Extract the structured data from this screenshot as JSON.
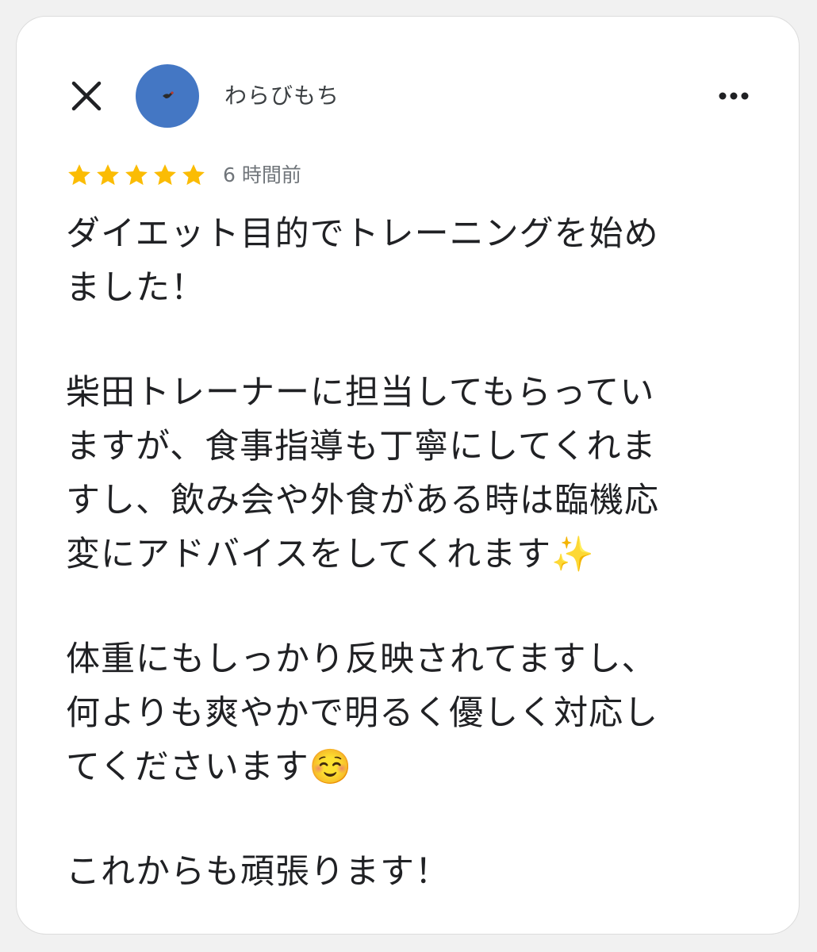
{
  "review": {
    "author": "わらびもち",
    "time": "6 時間前",
    "stars": 5,
    "star_color": "#fbbc04",
    "avatar_color": "#4477c4",
    "paragraphs": [
      "ダイエット目的でトレーニングを始め\nました！",
      "柴田トレーナーに担当してもらってい\nますが、食事指導も丁寧にしてくれま\nすし、飲み会や外食がある時は臨機応\n変にアドバイスをしてくれます✨",
      "体重にもしっかり反映されてますし、\n何よりも爽やかで明るく優しく対応し\nてくださいます☺️",
      "これからも頑張ります！"
    ]
  },
  "icons": {
    "close": "close-icon",
    "more": "more-horizontal-icon",
    "star": "star-icon"
  }
}
